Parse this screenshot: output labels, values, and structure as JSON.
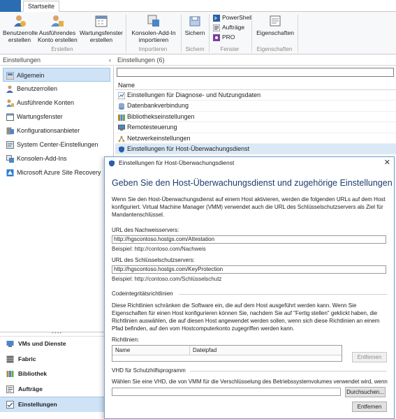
{
  "ribbon": {
    "tab_home": "Startseite",
    "groups": {
      "erstellen": {
        "label": "Erstellen",
        "buttons": [
          "Benutzerrolle\nerstellen",
          "Ausführendes\nKonto erstellen",
          "Wartungsfenster\nerstellen"
        ]
      },
      "importieren": {
        "label": "Importieren",
        "button": "Konsolen-Add-In\nimportieren"
      },
      "sichern": {
        "label": "Sichern",
        "button": "Sichern"
      },
      "fenster": {
        "label": "Fenster",
        "items": [
          "PowerShell",
          "Aufträge",
          "PRO"
        ]
      },
      "eigenschaften": {
        "label": "Eigenschaften",
        "button": "Eigenschaften"
      }
    }
  },
  "nav": {
    "header": "Einstellungen",
    "chevron": "‹",
    "items": [
      "Allgemein",
      "Benutzerrollen",
      "Ausführende Konten",
      "Wartungsfenster",
      "Konfigurationsanbieter",
      "System Center-Einstellungen",
      "Konsolen-Add-Ins",
      "Microsoft Azure Site Recovery"
    ]
  },
  "workspaces": {
    "items": [
      "VMs und Dienste",
      "Fabric",
      "Bibliothek",
      "Aufträge",
      "Einstellungen"
    ]
  },
  "main": {
    "header": "Einstellungen (6)",
    "column_name": "Name",
    "rows": [
      "Einstellungen für Diagnose- und Nutzungsdaten",
      "Datenbankverbindung",
      "Bibliothekseinstellungen",
      "Remotesteuerung",
      "Netzwerkeinstellungen",
      "Einstellungen für Host-Überwachungsdienst"
    ]
  },
  "dialog": {
    "title": "Einstellungen für Host-Überwachungsdienst",
    "close": "✕",
    "heading": "Geben Sie den Host-Überwachungsdienst und zugehörige Einstellungen an.",
    "intro": "Wenn Sie den Host-Überwachungsdienst auf einem Host aktivieren, werden die folgenden URLs auf dem Host konfiguriert. Virtual Machine Manager (VMM) verwendet auch die URL des Schlüsselschutzservers als Ziel für Mandantenschlüssel.",
    "attestation_label": "URL des Nachweisservers:",
    "attestation_value": "http://hgscontoso.hostgs.com/Attestation",
    "attestation_example": "Beispiel: http://contoso.com/Nachweis",
    "keyprotection_label": "URL des Schlüsselschutzservers:",
    "keyprotection_value": "http://hgscontoso.hostgs.com/KeyProtection",
    "keyprotection_example": "Beispiel: http://contoso.com/Schlüsselschutz",
    "ci_section": "Codeintegritätsrichtlinien",
    "ci_text": "Diese Richtlinien schränken die Software ein, die auf dem Host ausgeführt werden kann. Wenn Sie Eigenschaften für einen Host konfigurieren können Sie, nachdem Sie auf \"Fertig stellen\" geklickt haben, die Richtlinien auswählen, die auf diesen Host angewendet werden sollen, wenn sich diese Richtlinien an einem Pfad befinden, auf den vom Hostcomputerkonto zugegriffen werden kann.",
    "policies_label": "Richtlinien:",
    "grid_col_name": "Name",
    "grid_col_path": "Dateipfad",
    "btn_remove_1": "Entfernen",
    "vhd_section": "VHD für Schutzhilfsprogramm",
    "vhd_text": "Wählen Sie eine VHD, die von VMM für die Verschlüsselung des Betriebssystemvolumes verwendet wird, wenn v",
    "btn_browse": "Durchsuchen...",
    "btn_remove_2": "Entfernen"
  },
  "colors": {
    "accent": "#2b6cb3",
    "selection": "#cfe3f7",
    "heading": "#1c3d6e"
  }
}
